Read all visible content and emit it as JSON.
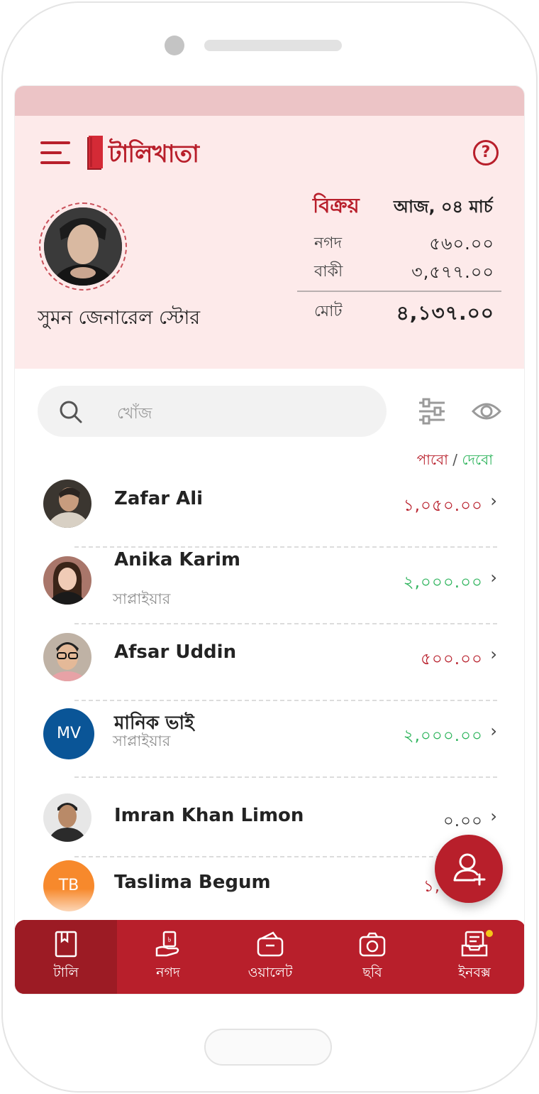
{
  "app": {
    "logo_text": "টালিখাতা"
  },
  "store": {
    "name": "সুমন জেনারেল স্টোর"
  },
  "sales": {
    "title": "বিক্রয়",
    "date": "আজ, ০৪ মার্চ",
    "cash_label": "নগদ",
    "cash_value": "৫৬০.০০",
    "due_label": "বাকী",
    "due_value": "৩,৫৭৭.০০",
    "total_label": "মোট",
    "total_value": "৪,১৩৭.০০"
  },
  "search": {
    "placeholder": "খোঁজ"
  },
  "legend": {
    "receive": "পাবো",
    "separator": "/",
    "give": "দেবো"
  },
  "contacts": [
    {
      "name": "Zafar Ali",
      "role": "",
      "amount": "১,০৫০.০০",
      "status": "receive"
    },
    {
      "name": "Anika Karim",
      "role": "সাপ্লাইয়ার",
      "amount": "২,০০০.০০",
      "status": "give"
    },
    {
      "name": "Afsar Uddin",
      "role": "",
      "amount": "৫০০.০০",
      "status": "receive"
    },
    {
      "name": "মানিক ভাই",
      "role": "সাপ্লাইয়ার",
      "amount": "২,০০০.০০",
      "status": "give",
      "initials": "MV",
      "avatar_color": "#0a5597"
    },
    {
      "name": "Imran Khan Limon",
      "role": "",
      "amount": "০.০০",
      "status": "neutral"
    },
    {
      "name": "Taslima Begum",
      "role": "",
      "amount": "১,৫",
      "status": "receive",
      "initials": "TB",
      "avatar_color": "#f7892c"
    }
  ],
  "nav": [
    {
      "label": "টালি",
      "icon": "tally-book-icon",
      "active": true
    },
    {
      "label": "নগদ",
      "icon": "cash-icon",
      "active": false
    },
    {
      "label": "ওয়ালেট",
      "icon": "wallet-icon",
      "active": false
    },
    {
      "label": "ছবি",
      "icon": "camera-icon",
      "active": false
    },
    {
      "label": "ইনবক্স",
      "icon": "inbox-icon",
      "active": false,
      "badge": true
    }
  ],
  "colors": {
    "brand": "#b81f2b",
    "brand_dark": "#9c1b24",
    "header_bg": "#fdeaea",
    "receive": "#b81f2b",
    "give": "#2bb35a",
    "badge": "#f5c518"
  }
}
